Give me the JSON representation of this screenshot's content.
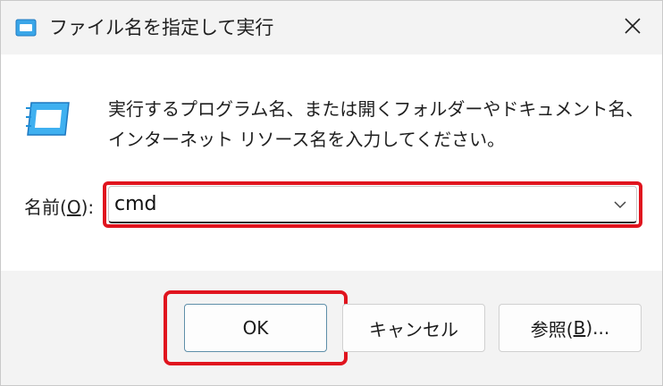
{
  "window": {
    "title": "ファイル名を指定して実行",
    "close_label": "✕"
  },
  "content": {
    "description": "実行するプログラム名、または開くフォルダーやドキュメント名、インターネット リソース名を入力してください。",
    "name_label_prefix": "名前(",
    "name_label_key": "O",
    "name_label_suffix": "):",
    "command_value": "cmd"
  },
  "buttons": {
    "ok_label": "OK",
    "cancel_label": "キャンセル",
    "browse_prefix": "参照(",
    "browse_key": "B",
    "browse_suffix": ")..."
  },
  "colors": {
    "highlight": "#e0141e",
    "icon_blue": "#1e8fd8"
  },
  "icons": {
    "title": "run-icon",
    "content": "run-icon",
    "close": "close-icon",
    "dropdown": "chevron-down-icon"
  }
}
